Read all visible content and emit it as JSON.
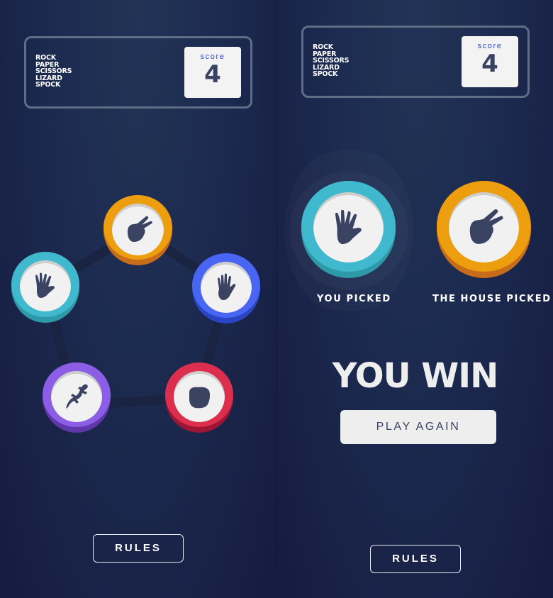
{
  "logo": {
    "lines": [
      "ROCK",
      "PAPER",
      "SCISSORS",
      "LIZARD",
      "SPOCK"
    ]
  },
  "left_panel": {
    "score": {
      "label": "score",
      "value": "4"
    },
    "choices": [
      {
        "name": "scissors",
        "icon": "scissors-icon",
        "color": "#ec9e0e"
      },
      {
        "name": "paper",
        "icon": "paper-icon",
        "color": "#4865f4"
      },
      {
        "name": "rock",
        "icon": "rock-icon",
        "color": "#dc2e4e"
      },
      {
        "name": "lizard",
        "icon": "lizard-icon",
        "color": "#8c5de5"
      },
      {
        "name": "spock",
        "icon": "spock-icon",
        "color": "#40b9ce"
      }
    ],
    "rules_label": "RULES"
  },
  "right_panel": {
    "score": {
      "label": "score",
      "value": "4"
    },
    "you_picked": {
      "label": "YOU PICKED",
      "choice": "spock",
      "icon": "spock-icon",
      "color": "#40b9ce"
    },
    "house_picked": {
      "label": "THE HOUSE PICKED",
      "choice": "scissors",
      "icon": "scissors-icon",
      "color": "#ec9e0e"
    },
    "result_text": "YOU WIN",
    "play_again_label": "PLAY AGAIN",
    "rules_label": "RULES"
  },
  "colors": {
    "scissors": "#ec9e0e",
    "paper": "#4865f4",
    "rock": "#dc2e4e",
    "lizard": "#8c5de5",
    "spock": "#40b9ce",
    "text_dark": "#3b4363",
    "score_label": "#2a46c0"
  }
}
